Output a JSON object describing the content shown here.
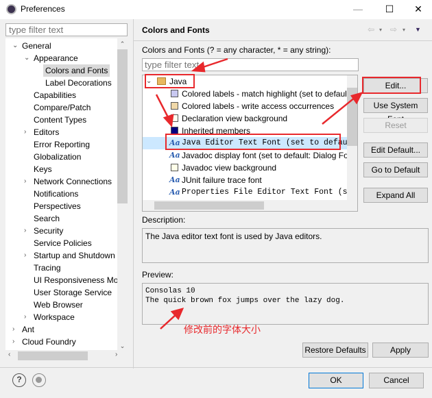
{
  "window": {
    "title": "Preferences",
    "minimize": "—",
    "maximize": "☐",
    "close": "✕"
  },
  "left": {
    "filter_placeholder": "type filter text",
    "tree": [
      {
        "label": "General",
        "level": 0,
        "state": "expanded"
      },
      {
        "label": "Appearance",
        "level": 1,
        "state": "expanded"
      },
      {
        "label": "Colors and Fonts",
        "level": 2,
        "selected": true
      },
      {
        "label": "Label Decorations",
        "level": 2
      },
      {
        "label": "Capabilities",
        "level": 1
      },
      {
        "label": "Compare/Patch",
        "level": 1
      },
      {
        "label": "Content Types",
        "level": 1
      },
      {
        "label": "Editors",
        "level": 1,
        "state": "collapsed"
      },
      {
        "label": "Error Reporting",
        "level": 1
      },
      {
        "label": "Globalization",
        "level": 1
      },
      {
        "label": "Keys",
        "level": 1
      },
      {
        "label": "Network Connections",
        "level": 1,
        "state": "collapsed"
      },
      {
        "label": "Notifications",
        "level": 1
      },
      {
        "label": "Perspectives",
        "level": 1
      },
      {
        "label": "Search",
        "level": 1
      },
      {
        "label": "Security",
        "level": 1,
        "state": "collapsed"
      },
      {
        "label": "Service Policies",
        "level": 1
      },
      {
        "label": "Startup and Shutdown",
        "level": 1,
        "state": "collapsed"
      },
      {
        "label": "Tracing",
        "level": 1
      },
      {
        "label": "UI Responsiveness Mo",
        "level": 1
      },
      {
        "label": "User Storage Service",
        "level": 1
      },
      {
        "label": "Web Browser",
        "level": 1
      },
      {
        "label": "Workspace",
        "level": 1,
        "state": "collapsed"
      },
      {
        "label": "Ant",
        "level": 0,
        "state": "collapsed"
      },
      {
        "label": "Cloud Foundry",
        "level": 0,
        "state": "collapsed"
      }
    ]
  },
  "page": {
    "title": "Colors and Fonts",
    "filter_label": "Colors and Fonts (? = any character, * = any string):",
    "filter_placeholder": "type filter text",
    "category": "Java",
    "items": [
      {
        "label": "Colored labels - match highlight (set to defaul",
        "icon": "swatch",
        "color": "#c8c8f0"
      },
      {
        "label": "Colored labels - write access occurrences",
        "icon": "swatch",
        "color": "#f0d8a8"
      },
      {
        "label": "Declaration view background",
        "icon": "swatch",
        "color": "#fffff0"
      },
      {
        "label": "Inherited members",
        "icon": "swatch",
        "color": "#000080"
      },
      {
        "label": "Java Editor Text Font (set to default:",
        "icon": "font",
        "mono": true,
        "selected": true
      },
      {
        "label": "Javadoc display font (set to default: Dialog Fo",
        "icon": "font"
      },
      {
        "label": "Javadoc view background",
        "icon": "swatch",
        "color": "#ffffe8"
      },
      {
        "label": "JUnit failure trace font",
        "icon": "font"
      },
      {
        "label": "Properties File Editor Text Font (set t",
        "icon": "font",
        "mono": true
      }
    ],
    "buttons": {
      "edit": "Edit...",
      "use_system_font": "Use System Font",
      "reset": "Reset",
      "edit_default": "Edit Default...",
      "go_to_default": "Go to Default",
      "expand_all": "Expand All"
    },
    "description_label": "Description:",
    "description": "The Java editor text font is used by Java editors.",
    "preview_label": "Preview:",
    "preview_font": "Consolas 10",
    "preview_sample": "The quick brown fox jumps over the lazy dog.",
    "annotation": "修改前的字体大小",
    "restore_defaults": "Restore Defaults",
    "apply": "Apply"
  },
  "footer": {
    "ok": "OK",
    "cancel": "Cancel"
  },
  "colors": {
    "annotation_red": "#e8282c",
    "selection": "#cce8ff",
    "accent": "#0078d7"
  }
}
